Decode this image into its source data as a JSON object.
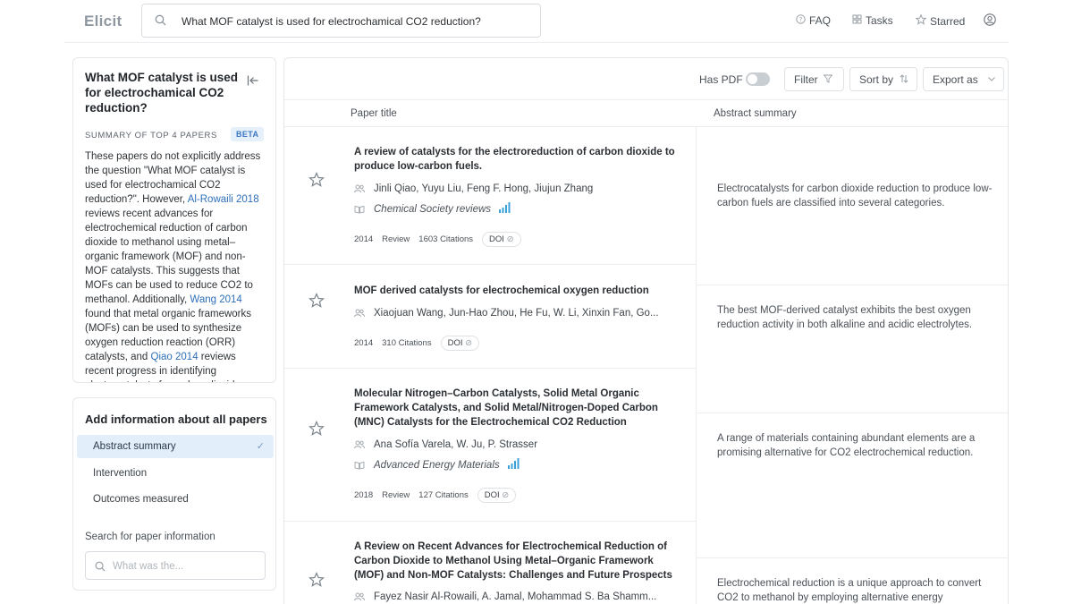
{
  "app": {
    "logo": "Elicit"
  },
  "header": {
    "search_value": "What MOF catalyst is used for electrochamical CO2 reduction?",
    "faq": "FAQ",
    "tasks": "Tasks",
    "starred": "Starred"
  },
  "left": {
    "question": "What MOF catalyst is used for electrochamical CO2 reduction?",
    "summary_heading": "SUMMARY OF TOP 4 PAPERS",
    "beta": "BETA",
    "summary": {
      "p1": "These papers do not explicitly address the question \"What MOF catalyst is used for electrochamical CO2 reduction?\". However, ",
      "link1": "Al-Rowaili 2018",
      "p2": " reviews recent advances for electrochemical reduction of carbon dioxide to methanol using metal–organic framework (MOF) and non-MOF catalysts. This suggests that MOFs can be used to reduce CO2 to methanol. Additionally, ",
      "link2": "Wang 2014",
      "p3": " found that metal organic frameworks (MOFs) can be used to synthesize oxygen reduction reaction (ORR) catalysts, and ",
      "link3": "Qiao 2014",
      "p4": " reviews recent progress in identifying electrocatalysts for carbon dioxide"
    },
    "add_info_title": "Add information about all papers",
    "options": [
      "Abstract summary",
      "Intervention",
      "Outcomes measured"
    ],
    "search_label": "Search for paper information",
    "search_placeholder": "What was the..."
  },
  "toolbar": {
    "has_pdf": "Has PDF",
    "filter": "Filter",
    "sort_by": "Sort by",
    "export_as": "Export as"
  },
  "columns": {
    "title": "Paper title",
    "abstract": "Abstract summary"
  },
  "papers": [
    {
      "title": "A review of catalysts for the electroreduction of carbon dioxide to produce low-carbon fuels.",
      "authors": "Jinli Qiao, Yuyu Liu, Feng F. Hong, Jiujun Zhang",
      "journal": "Chemical Society reviews",
      "year": "2014",
      "type": "Review",
      "citations": "1603 Citations",
      "doi": "DOI",
      "abstract": "Electrocatalysts for carbon dioxide reduction to produce low-carbon fuels are classified into several categories."
    },
    {
      "title": "MOF derived catalysts for electrochemical oxygen reduction",
      "authors": "Xiaojuan Wang, Jun-Hao Zhou, He Fu, W. Li, Xinxin Fan, Go...",
      "year": "2014",
      "citations": "310 Citations",
      "doi": "DOI",
      "abstract": "The best MOF-derived catalyst exhibits the best oxygen reduction activity in both alkaline and acidic electrolytes."
    },
    {
      "title": "Molecular Nitrogen–Carbon Catalysts, Solid Metal Organic Framework Catalysts, and Solid Metal/Nitrogen-Doped Carbon (MNC) Catalysts for the Electrochemical CO2 Reduction",
      "authors": "Ana Sofía Varela, W. Ju, P. Strasser",
      "journal": "Advanced Energy Materials",
      "year": "2018",
      "type": "Review",
      "citations": "127 Citations",
      "doi": "DOI",
      "abstract": "A range of materials containing abundant elements are a promising alternative for CO2 electrochemical reduction."
    },
    {
      "title": "A Review on Recent Advances for Electrochemical Reduction of Carbon Dioxide to Methanol Using Metal–Organic Framework (MOF) and Non-MOF Catalysts: Challenges and Future Prospects",
      "authors": "Fayez Nasir Al-Rowaili, A. Jamal, Mohammad S. Ba Shamm...",
      "abstract": "Electrochemical reduction is a unique approach to convert CO2 to methanol by employing alternative energy"
    }
  ]
}
